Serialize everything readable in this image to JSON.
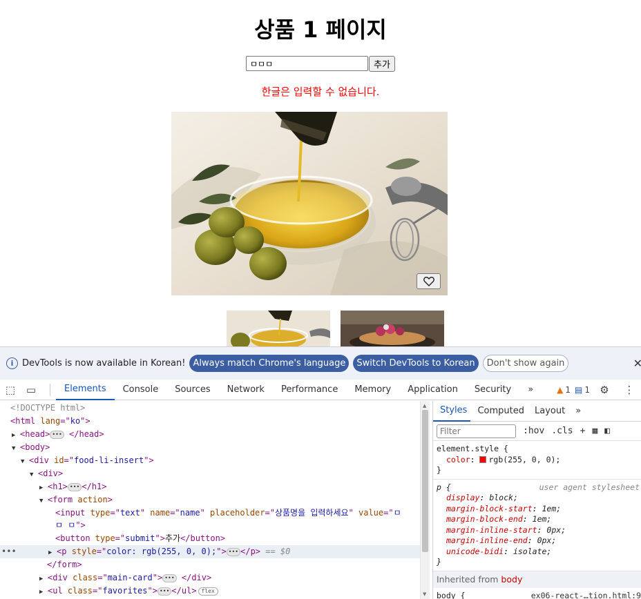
{
  "page": {
    "title": "상품 1 페이지",
    "input_value": "ㅁㅁㅁ",
    "add_label": "추가",
    "error": "한글은 입력할 수 없습니다.",
    "heart_icon": "heart-icon"
  },
  "infobar": {
    "message": "DevTools is now available in Korean!",
    "match_language": "Always match Chrome's language",
    "switch_korean": "Switch DevTools to Korean",
    "dont_show": "Don't show again",
    "close": "✕"
  },
  "tabs": {
    "elements": "Elements",
    "console": "Console",
    "sources": "Sources",
    "network": "Network",
    "performance": "Performance",
    "memory": "Memory",
    "application": "Application",
    "security": "Security",
    "more": "»",
    "warn_count": "1",
    "msg_count": "1"
  },
  "dom": {
    "doctype": "<!DOCTYPE html>",
    "html_lang": "ko",
    "div_id": "food-li-insert",
    "input_type": "text",
    "input_name": "name",
    "input_placeholder": "상품명을 입력하세요",
    "input_value_1": "ㅁ",
    "input_value_2": "ㅁ ㅁ",
    "button_type": "submit",
    "button_text": "추가",
    "p_style": "color: rgb(255, 0, 0);",
    "eq0": "== $0",
    "main_card_class": "main-card",
    "ul_class": "favorites",
    "flex_badge": "flex"
  },
  "styles": {
    "tab_styles": "Styles",
    "tab_computed": "Computed",
    "tab_layout": "Layout",
    "more": "»",
    "filter_placeholder": "Filter",
    "hov": ":hov",
    "cls": ".cls",
    "element_style": "element.style {",
    "color_prop": "color",
    "color_val": "rgb(255, 0, 0);",
    "p_selector": "p {",
    "ua_source": "user agent stylesheet",
    "display": "display",
    "display_val": "block;",
    "mbs": "margin-block-start",
    "mbs_val": "1em;",
    "mbe": "margin-block-end",
    "mbe_val": "1em;",
    "mis": "margin-inline-start",
    "mis_val": "0px;",
    "mie": "margin-inline-end",
    "mie_val": "0px;",
    "ub": "unicode-bidi",
    "ub_val": "isolate;",
    "close_brace": "}",
    "inherited_label": "Inherited from",
    "inherited_tag": "body",
    "body_selector": "body {",
    "body_source": "ex06-react-…tion.html:9"
  }
}
